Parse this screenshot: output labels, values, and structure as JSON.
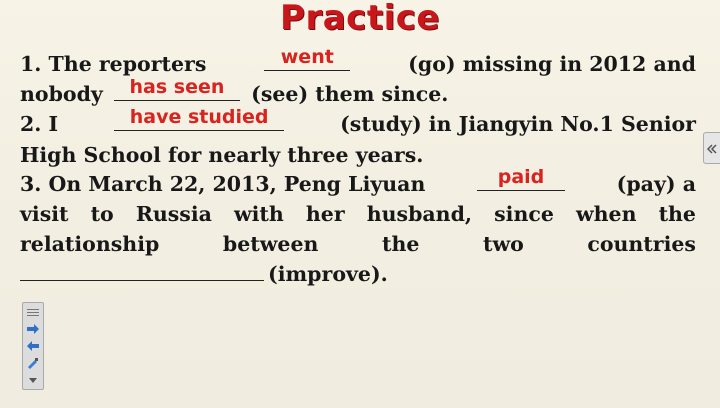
{
  "slide": {
    "title": "Practice",
    "q1": {
      "a": "1. The reporters",
      "answer1": "went",
      "b": "(go) missing in 2012 and",
      "c": "nobody",
      "answer2": "has seen",
      "d": "(see) them since."
    },
    "q2": {
      "a": "2. I",
      "answer": "have studied",
      "b": "(study) in Jiangyin No.1 Senior",
      "c": "High School for nearly three years."
    },
    "q3": {
      "a": "3. On March 22, 2013, Peng Liyuan",
      "answer": "paid",
      "b": "(pay) a",
      "line2": [
        "visit",
        "to",
        "Russia",
        "with",
        "her",
        "husband,",
        "since",
        "when",
        "the"
      ],
      "line3": [
        "relationship",
        "between",
        "the",
        "two",
        "countries"
      ],
      "d": "(improve)."
    }
  },
  "toolbar": {
    "icons": [
      "grip-icon",
      "arrow-right-icon",
      "arrow-left-icon",
      "pen-icon",
      "menu-down-icon"
    ]
  },
  "side_tab": {
    "icon": "double-chevron-left-icon"
  },
  "colors": {
    "answer": "#d8231f",
    "title": "#c8161b",
    "text": "#181818"
  }
}
